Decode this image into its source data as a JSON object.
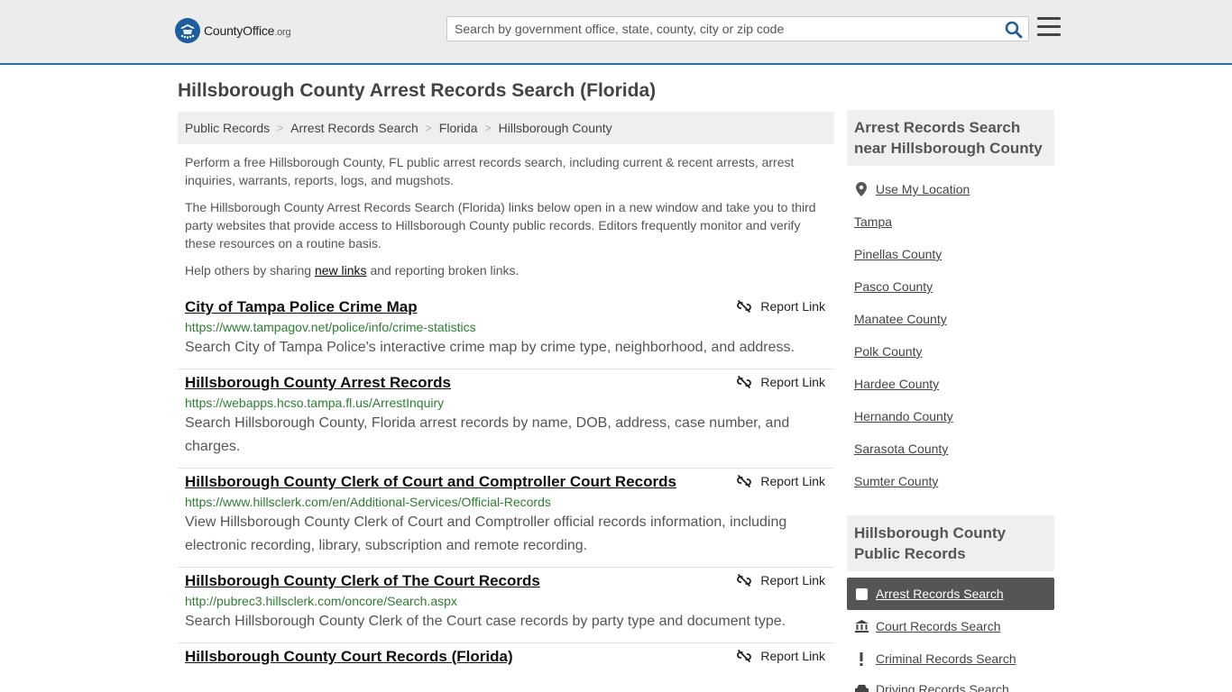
{
  "header": {
    "logo_text": "CountyOffice",
    "logo_suffix": ".org",
    "search_placeholder": "Search by government office, state, county, city or zip code"
  },
  "page_title": "Hillsborough County Arrest Records Search (Florida)",
  "breadcrumb": [
    "Public Records",
    "Arrest Records Search",
    "Florida",
    "Hillsborough County"
  ],
  "intro": {
    "p1": "Perform a free Hillsborough County, FL public arrest records search, including current & recent arrests, arrest inquiries, warrants, reports, logs, and mugshots.",
    "p2": "The Hillsborough County Arrest Records Search (Florida) links below open in a new window and take you to third party websites that provide access to Hillsborough County public records. Editors frequently monitor and verify these resources on a routine basis.",
    "p3_before": "Help others by sharing ",
    "p3_link": "new links",
    "p3_after": " and reporting broken links."
  },
  "report_label": "Report Link",
  "results": [
    {
      "title": "City of Tampa Police Crime Map",
      "url": "https://www.tampagov.net/police/info/crime-statistics",
      "desc": "Search City of Tampa Police's interactive crime map by crime type, neighborhood, and address."
    },
    {
      "title": "Hillsborough County Arrest Records",
      "url": "https://webapps.hcso.tampa.fl.us/ArrestInquiry",
      "desc": "Search Hillsborough County, Florida arrest records by name, DOB, address, case number, and charges."
    },
    {
      "title": "Hillsborough County Clerk of Court and Comptroller Court Records",
      "url": "https://www.hillsclerk.com/en/Additional-Services/Official-Records",
      "desc": "View Hillsborough County Clerk of Court and Comptroller official records information, including electronic recording, library, subscription and remote recording."
    },
    {
      "title": "Hillsborough County Clerk of The Court Records",
      "url": "http://pubrec3.hillsclerk.com/oncore/Search.aspx",
      "desc": "Search Hillsborough County Clerk of the Court case records by party type and document type."
    },
    {
      "title": "Hillsborough County Court Records (Florida)",
      "url": "",
      "desc": ""
    }
  ],
  "sidebar": {
    "nearby_heading": "Arrest Records Search near Hillsborough County",
    "use_location": "Use My Location",
    "nearby": [
      "Tampa",
      "Pinellas County",
      "Pasco County",
      "Manatee County",
      "Polk County",
      "Hardee County",
      "Hernando County",
      "Sarasota County",
      "Sumter County"
    ],
    "public_heading": "Hillsborough County Public Records",
    "public_active": "Arrest Records Search",
    "public_links": [
      "Court Records Search",
      "Criminal Records Search",
      "Driving Records Search"
    ]
  }
}
